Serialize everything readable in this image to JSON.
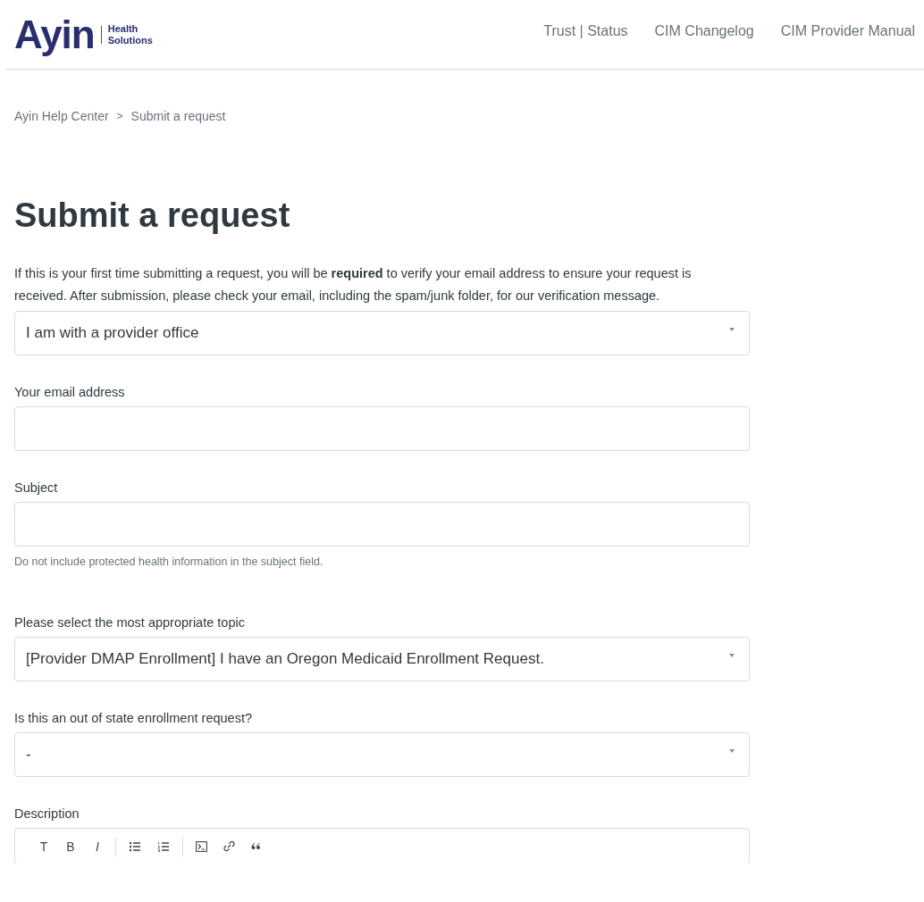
{
  "header": {
    "logo": {
      "wordmark": "Ayin",
      "tagline_1": "Health",
      "tagline_2": "Solutions"
    },
    "nav": [
      "Trust | Status",
      "CIM Changelog",
      "CIM Provider Manual"
    ]
  },
  "breadcrumb": {
    "items": [
      "Ayin Help Center",
      "Submit a request"
    ],
    "separator": ">"
  },
  "title": "Submit a request",
  "intro": "If this is your first time submitting a request, you will be **required** to verify your email address to ensure your request is received. After submission, please check your email, including the spam/junk folder, for our verification message.",
  "fields": [
    {
      "kind": "select",
      "value": "I am with a provider office"
    },
    {
      "kind": "input",
      "label": "Your email address"
    },
    {
      "kind": "input",
      "label": "Subject",
      "hint": "Do not include protected health information in the subject field."
    },
    {
      "kind": "select",
      "label": "Please select the most appropriate topic",
      "value": "[Provider DMAP Enrollment] I have an Oregon Medicaid Enrollment Request."
    },
    {
      "kind": "select",
      "label": "Is this an out of state enrollment request?",
      "value": "-"
    },
    {
      "kind": "editor",
      "label": "Description",
      "toolbar": [
        "T",
        "B",
        "I"
      ]
    }
  ]
}
